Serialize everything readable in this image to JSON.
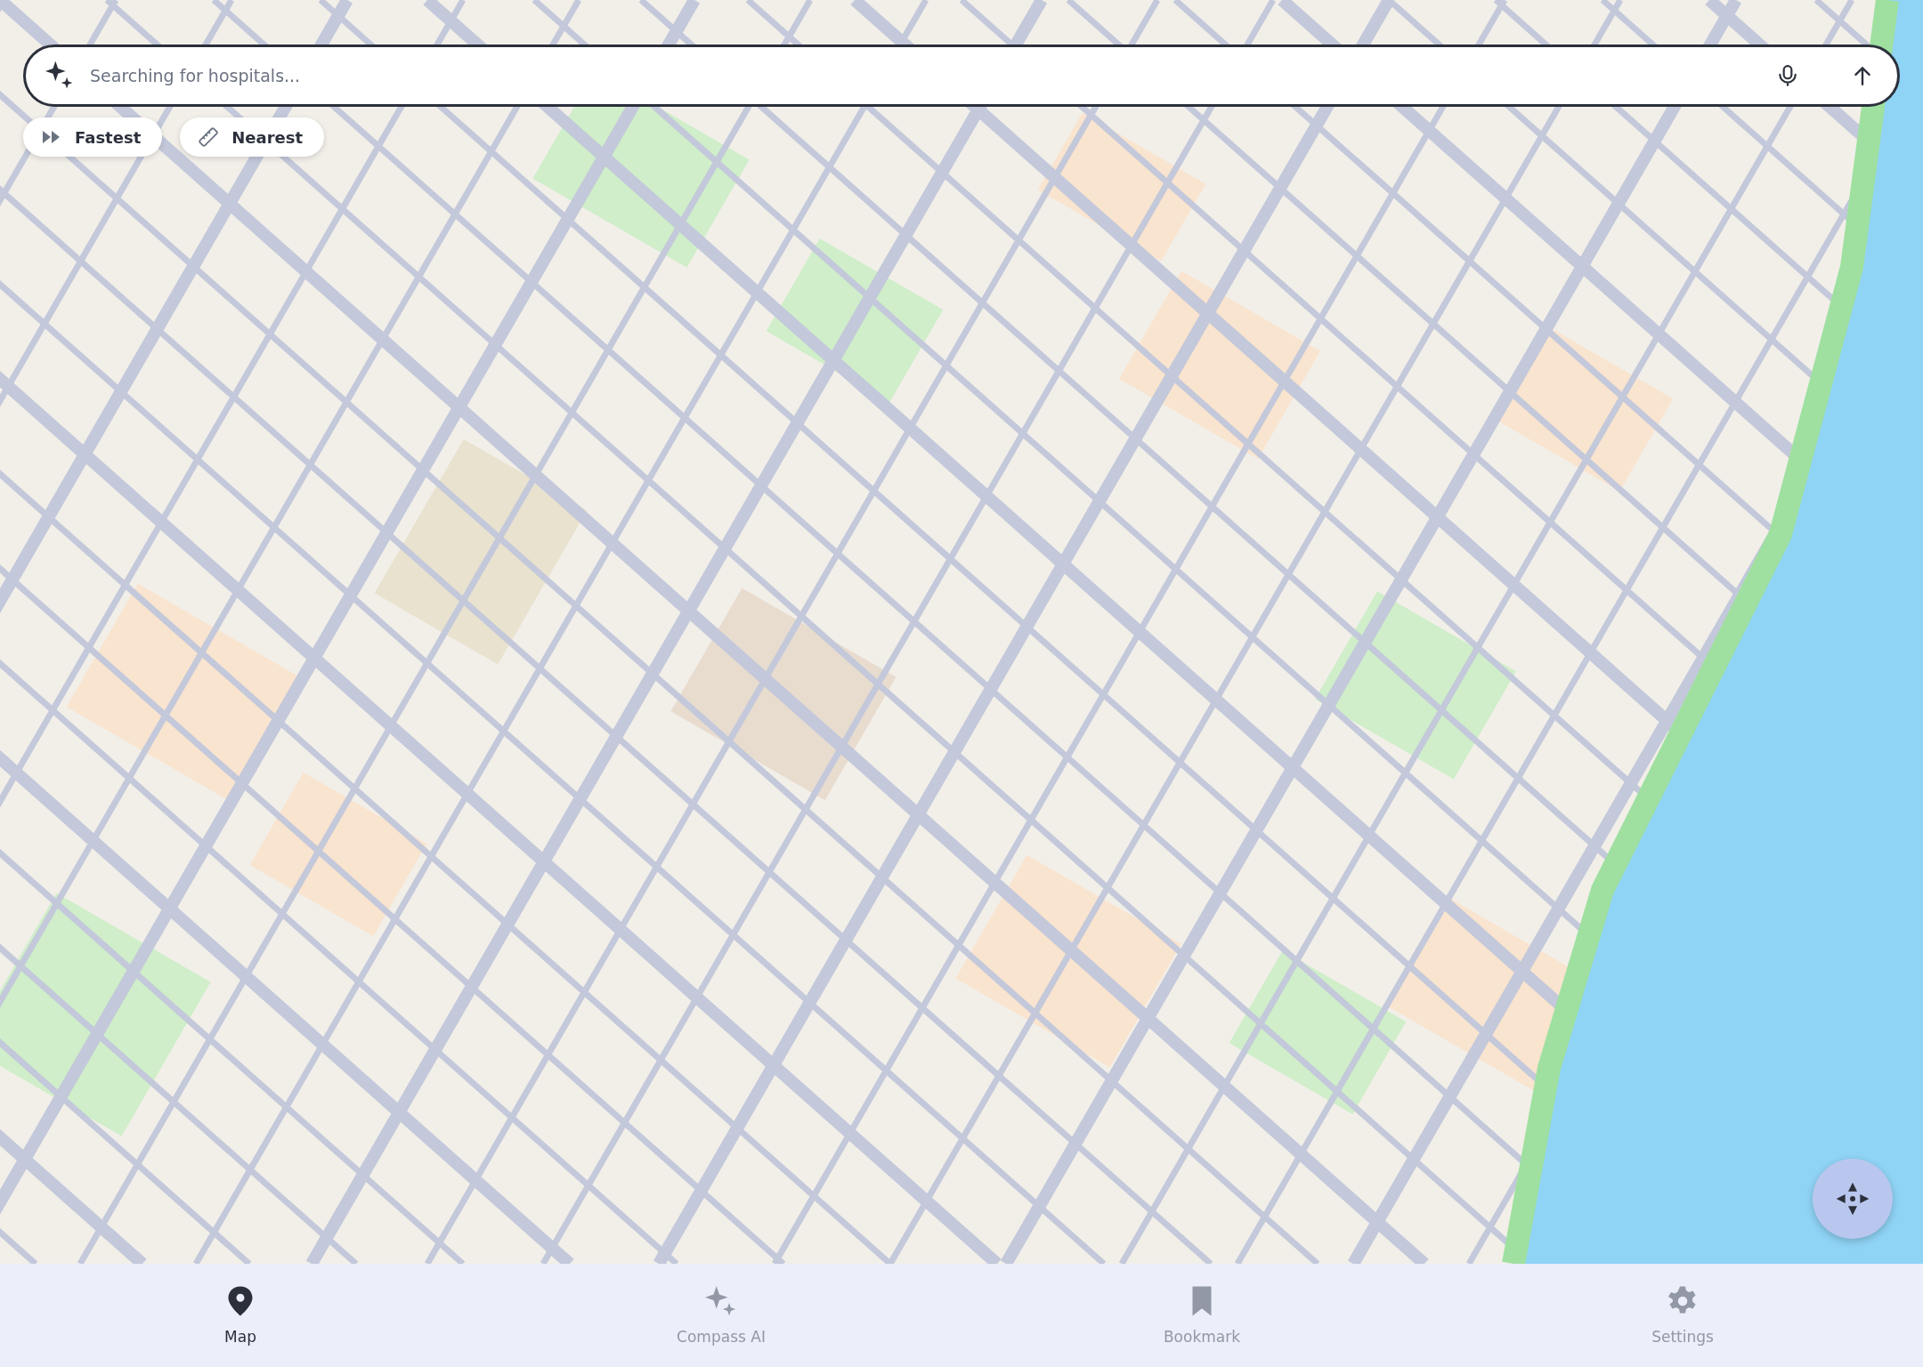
{
  "search": {
    "placeholder": "Searching for hospitals..."
  },
  "filters": [
    {
      "label": "Fastest",
      "kind": "speed"
    },
    {
      "label": "Nearest",
      "kind": "distance"
    }
  ],
  "nav": [
    {
      "label": "Map",
      "kind": "map",
      "selected": true
    },
    {
      "label": "Compass AI",
      "kind": "ai",
      "selected": false
    },
    {
      "label": "Bookmark",
      "kind": "bookmark",
      "selected": false
    },
    {
      "label": "Settings",
      "kind": "settings",
      "selected": false
    }
  ]
}
